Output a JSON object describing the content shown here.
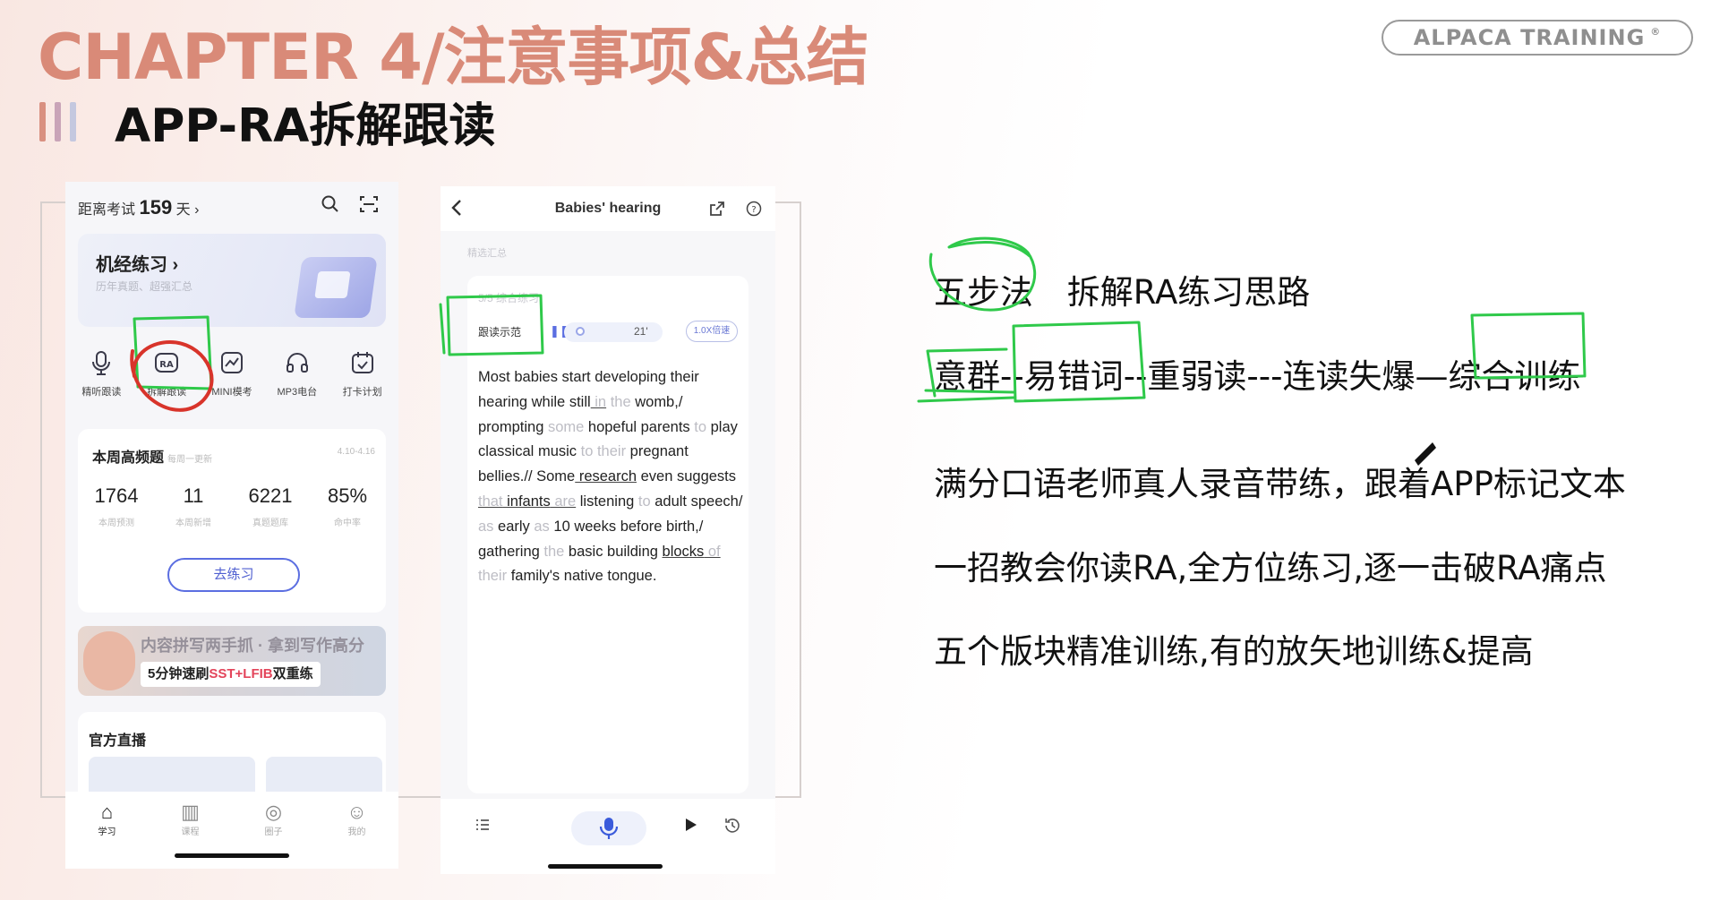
{
  "slide": {
    "chapter_title": "CHAPTER 4/注意事项&总结",
    "subtitle": "APP-RA拆解跟读",
    "brand": "ALPACA TRAINING",
    "brand_mark": "®",
    "bar_colors": [
      "#d99080",
      "#c9a4b8",
      "#c4c8df"
    ]
  },
  "phone_home": {
    "countdown_label": "距离考试",
    "countdown_days": "159",
    "countdown_unit": "天 ›",
    "search_icon": "search-icon",
    "scan_icon": "scan-icon",
    "practice_card": {
      "title": "机经练习 ›",
      "subtitle": "历年真题、超强汇总"
    },
    "tools": [
      {
        "icon": "microphone-icon",
        "glyph": "🎙",
        "label": "精听跟读"
      },
      {
        "icon": "ra-icon",
        "glyph": "RA",
        "label": "拆解跟读"
      },
      {
        "icon": "chart-icon",
        "glyph": "📈",
        "label": "MINI模考"
      },
      {
        "icon": "headphones-icon",
        "glyph": "🎧",
        "label": "MP3电台"
      },
      {
        "icon": "calendar-check-icon",
        "glyph": "📅",
        "label": "打卡计划"
      }
    ],
    "weekly": {
      "title": "本周高频题",
      "tag": "每周一更新",
      "date_range": "4.10-4.16",
      "stats": [
        {
          "value": "1764",
          "label": "本周预测"
        },
        {
          "value": "11",
          "label": "本周新增"
        },
        {
          "value": "6221",
          "label": "真题题库"
        },
        {
          "value": "85%",
          "label": "命中率"
        }
      ],
      "button": "去练习"
    },
    "banner": {
      "line1": "内容拼写两手抓 · 拿到写作高分",
      "line2_prefix": "5分钟速刷",
      "line2_highlight": "SST+LFIB",
      "line2_suffix": "双重练"
    },
    "live_title": "官方直播",
    "tabs": [
      {
        "icon": "home-icon",
        "glyph": "⌂",
        "label": "学习"
      },
      {
        "icon": "book-icon",
        "glyph": "▥",
        "label": "课程"
      },
      {
        "icon": "compass-icon",
        "glyph": "◎",
        "label": "圈子"
      },
      {
        "icon": "profile-icon",
        "glyph": "☺",
        "label": "我的"
      }
    ]
  },
  "phone_reader": {
    "title": "Babies' hearing",
    "crumb": "精选汇总",
    "progress": "5/5 综合练习",
    "demo_label": "跟读示范",
    "time": "21'",
    "speed": "1.0X倍速",
    "playback_progress": 0.05,
    "passage": [
      {
        "t": "Most ",
        "s": "n"
      },
      {
        "t": "babies",
        "s": "n"
      },
      {
        "t": " start ",
        "s": "n"
      },
      {
        "t": "developing",
        "s": "n"
      },
      {
        "t": " their ",
        "s": "n"
      },
      {
        "t": "hearing",
        "s": "n"
      },
      {
        "t": " while ",
        "s": "n"
      },
      {
        "t": "still",
        "s": "n"
      },
      {
        "t": " in",
        "s": "lu"
      },
      {
        "t": " the",
        "s": "l"
      },
      {
        "t": " womb,/ ",
        "s": "n"
      },
      {
        "t": "prompting",
        "s": "n"
      },
      {
        "t": " some ",
        "s": "l"
      },
      {
        "t": "hopeful",
        "s": "n"
      },
      {
        "t": " parents ",
        "s": "n"
      },
      {
        "t": "to",
        "s": "l"
      },
      {
        "t": " play ",
        "s": "n"
      },
      {
        "t": "classical",
        "s": "n"
      },
      {
        "t": " music ",
        "s": "n"
      },
      {
        "t": "to",
        "s": "l"
      },
      {
        "t": " their ",
        "s": "l"
      },
      {
        "t": "pregnant",
        "s": "n"
      },
      {
        "t": " bellies.// ",
        "s": "n"
      },
      {
        "t": "Some",
        "s": "n"
      },
      {
        "t": " research",
        "s": "nu"
      },
      {
        "t": " even",
        "s": "n"
      },
      {
        "t": " suggests ",
        "s": "n"
      },
      {
        "t": "that",
        "s": "lu"
      },
      {
        "t": " infants",
        "s": "nu"
      },
      {
        "t": " are",
        "s": "lu"
      },
      {
        "t": " listening ",
        "s": "n"
      },
      {
        "t": "to",
        "s": "l"
      },
      {
        "t": " adult ",
        "s": "n"
      },
      {
        "t": "speech/ ",
        "s": "n"
      },
      {
        "t": "as",
        "s": "l"
      },
      {
        "t": " early ",
        "s": "n"
      },
      {
        "t": "as",
        "s": "l"
      },
      {
        "t": " 10 weeks ",
        "s": "n"
      },
      {
        "t": "before birth,/ ",
        "s": "n"
      },
      {
        "t": "gathering",
        "s": "n"
      },
      {
        "t": " the ",
        "s": "l"
      },
      {
        "t": "basic",
        "s": "n"
      },
      {
        "t": " building ",
        "s": "n"
      },
      {
        "t": "blocks",
        "s": "nu"
      },
      {
        "t": " of",
        "s": "lu"
      },
      {
        "t": " their ",
        "s": "l"
      },
      {
        "t": "family's",
        "s": "n"
      },
      {
        "t": " native tongue.",
        "s": "n"
      }
    ],
    "bottom_icons": [
      "list-icon",
      "microphone-icon",
      "play-icon",
      "history-icon"
    ]
  },
  "notes": {
    "line1_a": "五步法",
    "line1_b": "拆解RA练习思路",
    "line2": "意群--易错词--重弱读---连读失爆—综合训练",
    "line3": "满分口语老师真人录音带练，跟着APP标记文本",
    "line4": "一招教会你读RA,全方位练习,逐一击破RA痛点",
    "line5": "五个版块精准训练,有的放矢地训练&提高"
  },
  "colors": {
    "chapter": "#d98a78",
    "annotation_green": "#2fc94a",
    "annotation_red": "#d8342b",
    "accent_blue": "#5b6ee1"
  }
}
